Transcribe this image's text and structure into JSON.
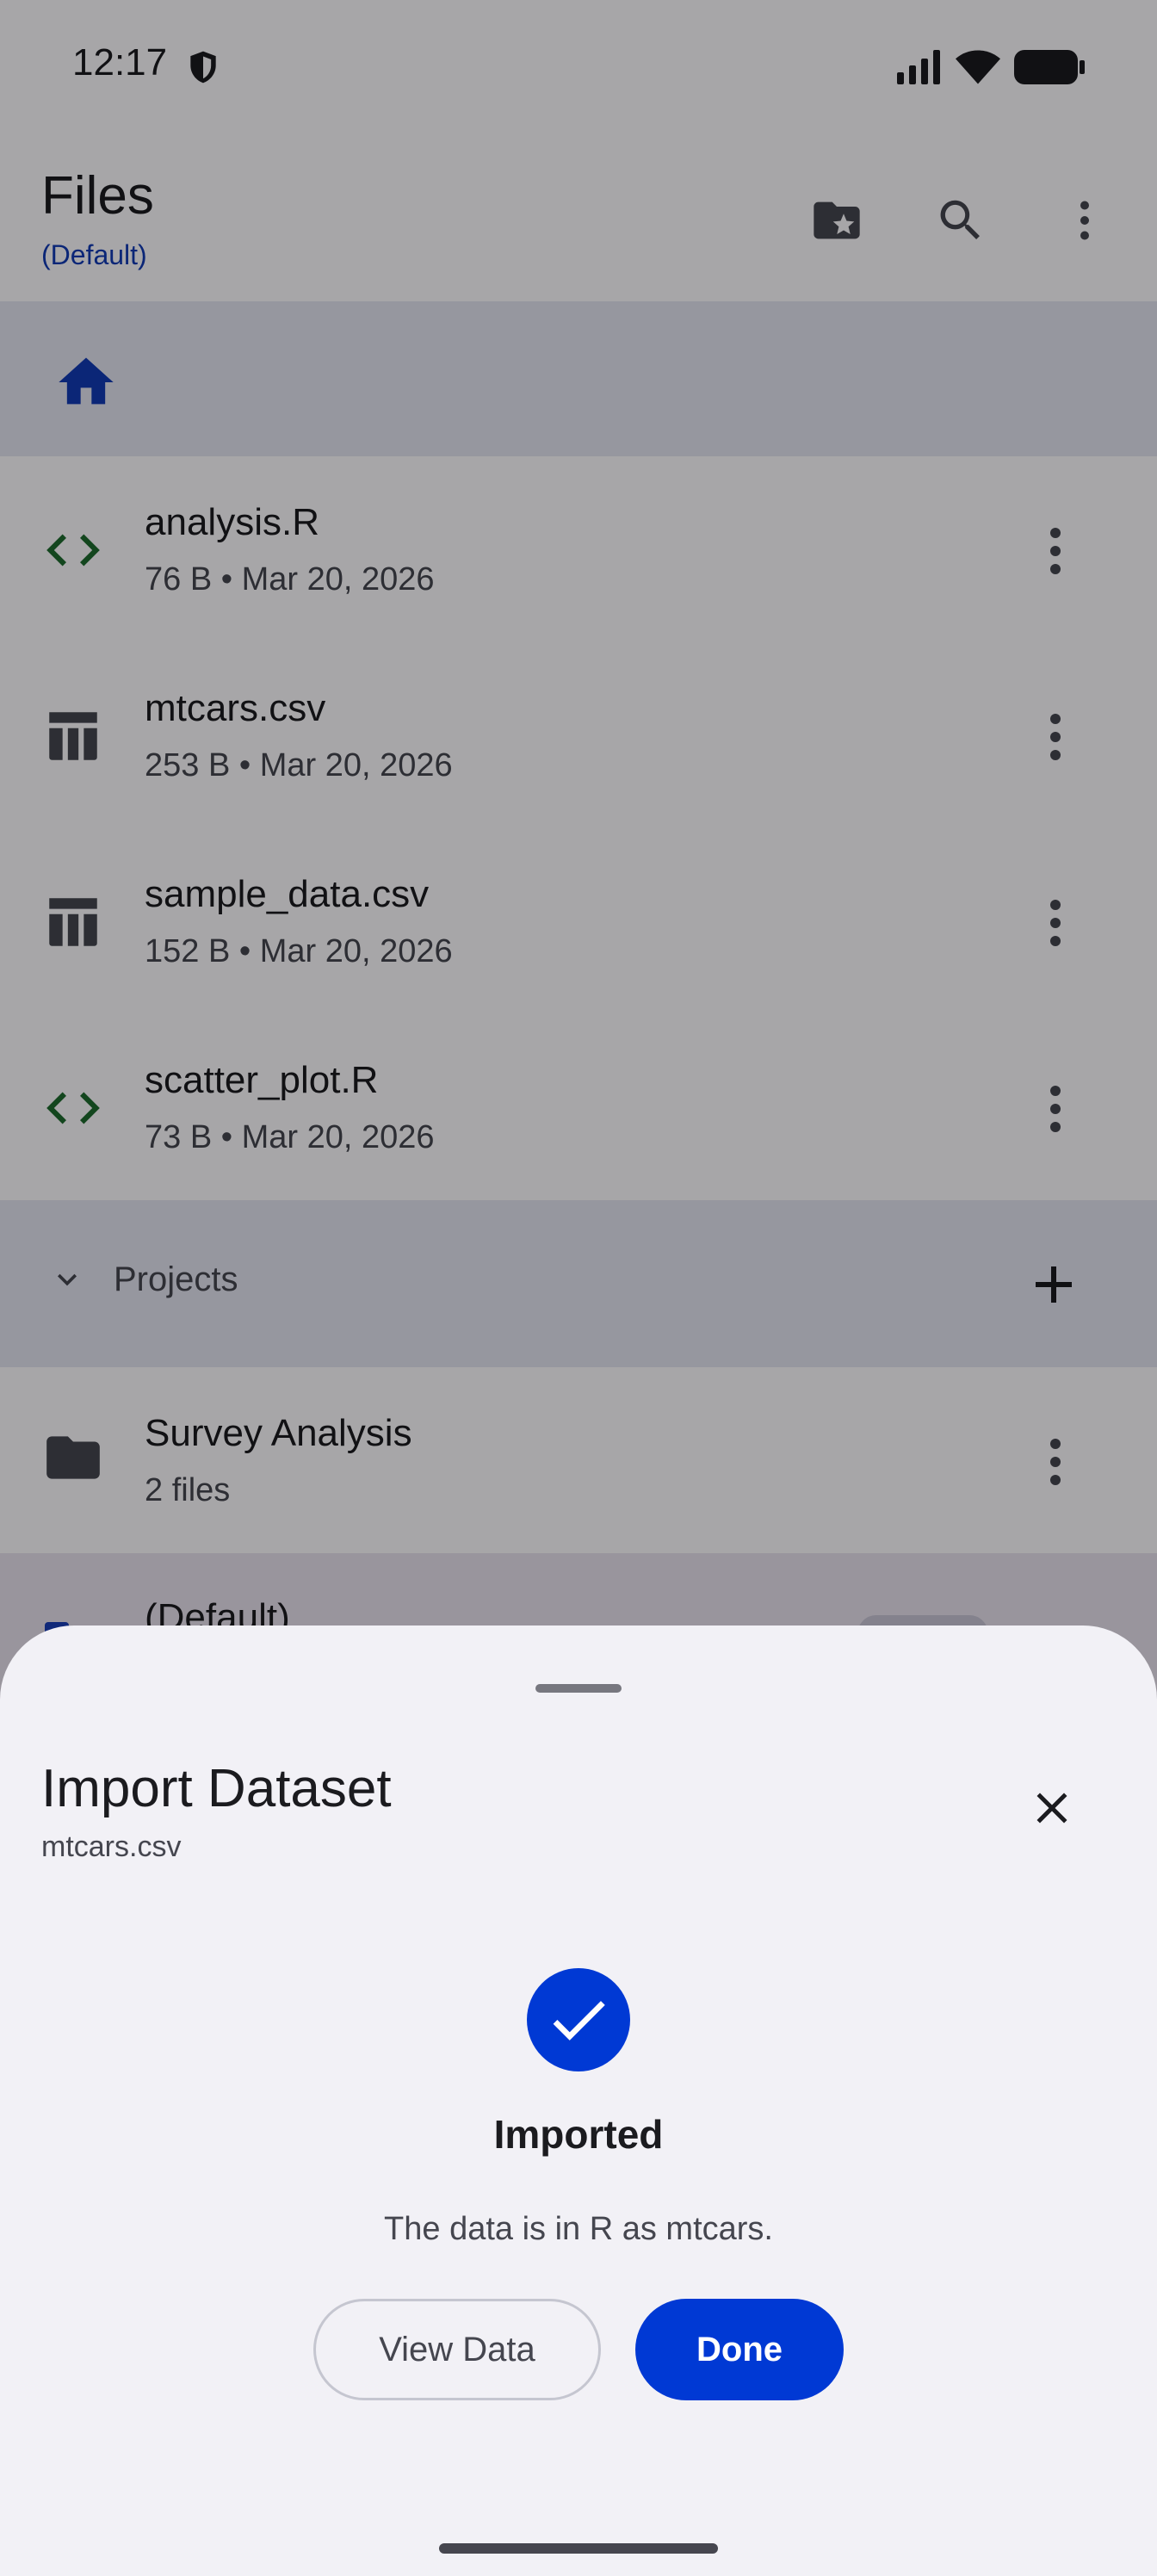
{
  "status_bar": {
    "time": "12:17"
  },
  "app_bar": {
    "title": "Files",
    "subtitle": "(Default)"
  },
  "files": [
    {
      "name": "analysis.R",
      "meta": "76 B • Mar 20, 2026",
      "icon": "code-icon"
    },
    {
      "name": "mtcars.csv",
      "meta": "253 B • Mar 20, 2026",
      "icon": "table-icon"
    },
    {
      "name": "sample_data.csv",
      "meta": "152 B • Mar 20, 2026",
      "icon": "table-icon"
    },
    {
      "name": "scatter_plot.R",
      "meta": "73 B • Mar 20, 2026",
      "icon": "code-icon"
    }
  ],
  "projects_section": {
    "label": "Projects",
    "items": [
      {
        "name": "Survey Analysis",
        "meta": "2 files"
      },
      {
        "name": "(Default)"
      }
    ]
  },
  "sheet": {
    "title": "Import Dataset",
    "subtitle": "mtcars.csv",
    "result_title": "Imported",
    "result_message": "The data is in R as mtcars.",
    "view_data_label": "View Data",
    "done_label": "Done"
  },
  "colors": {
    "accent": "#0039d4",
    "subtitle_link": "#123bb5",
    "code_icon": "#1e6b2e",
    "scrim": "rgba(0,0,0,0.34)"
  }
}
